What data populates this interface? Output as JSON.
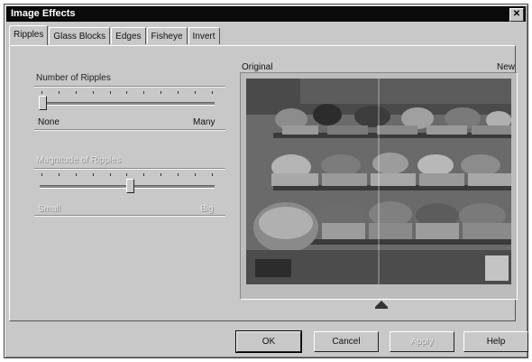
{
  "window": {
    "title": "Image Effects",
    "close_glyph": "✕"
  },
  "tabs": [
    {
      "label": "Ripples",
      "active": true
    },
    {
      "label": "Glass Blocks",
      "active": false
    },
    {
      "label": "Edges",
      "active": false
    },
    {
      "label": "Fisheye",
      "active": false
    },
    {
      "label": "Invert",
      "active": false
    }
  ],
  "ripples": {
    "number_label": "Number of Ripples",
    "number_min_label": "None",
    "number_max_label": "Many",
    "number_value_fraction": 0.0,
    "magnitude_label": "Magnitude of Ripples",
    "magnitude_min_label": "Small",
    "magnitude_max_label": "Big",
    "magnitude_value_fraction": 0.5,
    "magnitude_enabled": false
  },
  "preview": {
    "original_label": "Original",
    "new_label": "New",
    "split_fraction": 0.5
  },
  "buttons": {
    "ok": "OK",
    "cancel": "Cancel",
    "apply": "Apply",
    "help": "Help"
  },
  "colors": {
    "dialog_bg": "#c8c8c8",
    "titlebar_bg": "#0a0a0a"
  }
}
